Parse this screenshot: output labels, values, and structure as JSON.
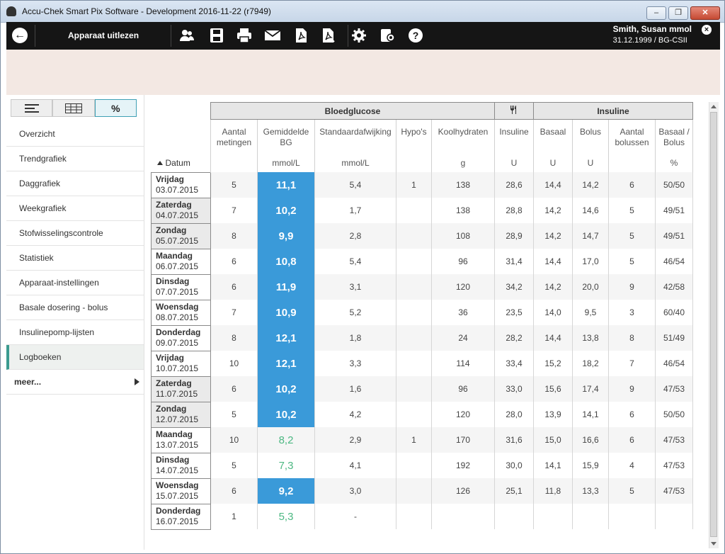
{
  "window": {
    "title": "Accu-Chek Smart Pix Software - Development 2016-11-22 (r7949)",
    "minimize": "–",
    "restore": "❐",
    "close": "✕"
  },
  "toolbar": {
    "back_icon": "arrow-left-icon",
    "title": "Apparaat uitlezen",
    "icons": [
      "users-icon",
      "save-icon",
      "print-icon",
      "mail-icon",
      "pdf-icon",
      "pdf-export-icon",
      "settings-icon",
      "device-settings-icon",
      "help-icon"
    ],
    "user_name": "Smith, Susan mmol",
    "user_dob": "31.12.1999 / BG-CSII",
    "close_icon": "close-icon"
  },
  "left": {
    "view_toggle": {
      "list": "list-view-icon",
      "table": "table-view-icon",
      "percent_label": "%"
    },
    "nav": [
      {
        "label": "Overzicht"
      },
      {
        "label": "Trendgrafiek"
      },
      {
        "label": "Daggrafiek"
      },
      {
        "label": "Weekgrafiek"
      },
      {
        "label": "Stofwisselingscontrole"
      },
      {
        "label": "Statistiek"
      },
      {
        "label": "Apparaat-instellingen"
      },
      {
        "label": "Basale dosering - bolus"
      },
      {
        "label": "Insulinepomp-lijsten"
      },
      {
        "label": "Logboeken",
        "active": true
      },
      {
        "label": "meer..."
      }
    ]
  },
  "table": {
    "group_headers": {
      "bg": "Bloedglucose",
      "food_icon": "cutlery-icon",
      "insulin": "Insuline"
    },
    "columns": {
      "datum": "Datum",
      "aantal": "Aantal metingen",
      "gem_bg": "Gemiddelde BG",
      "gem_bg_unit": "mmol/L",
      "sd": "Standaardafwijking",
      "sd_unit": "mmol/L",
      "hypos": "Hypo's",
      "kh": "Koolhydraten",
      "kh_unit": "g",
      "ins": "Insuline",
      "ins_unit": "U",
      "bas": "Basaal",
      "bas_unit": "U",
      "bol": "Bolus",
      "bol_unit": "U",
      "aant_bol": "Aantal bolussen",
      "bas_bol": "Basaal / Bolus",
      "bas_bol_unit": "%"
    },
    "rows": [
      {
        "day": "Vrijdag",
        "date": "03.07.2015",
        "n": "5",
        "bg": "11,1",
        "bg_high": true,
        "sd": "5,4",
        "hypo": "1",
        "kh": "138",
        "ins": "28,6",
        "bas": "14,4",
        "bol": "14,2",
        "nb": "6",
        "bb": "50/50",
        "weekend": false
      },
      {
        "day": "Zaterdag",
        "date": "04.07.2015",
        "n": "7",
        "bg": "10,2",
        "bg_high": true,
        "sd": "1,7",
        "hypo": "",
        "kh": "138",
        "ins": "28,8",
        "bas": "14,2",
        "bol": "14,6",
        "nb": "5",
        "bb": "49/51",
        "weekend": true
      },
      {
        "day": "Zondag",
        "date": "05.07.2015",
        "n": "8",
        "bg": "9,9",
        "bg_high": true,
        "sd": "2,8",
        "hypo": "",
        "kh": "108",
        "ins": "28,9",
        "bas": "14,2",
        "bol": "14,7",
        "nb": "5",
        "bb": "49/51",
        "weekend": true
      },
      {
        "day": "Maandag",
        "date": "06.07.2015",
        "n": "6",
        "bg": "10,8",
        "bg_high": true,
        "sd": "5,4",
        "hypo": "",
        "kh": "96",
        "ins": "31,4",
        "bas": "14,4",
        "bol": "17,0",
        "nb": "5",
        "bb": "46/54",
        "weekend": false
      },
      {
        "day": "Dinsdag",
        "date": "07.07.2015",
        "n": "6",
        "bg": "11,9",
        "bg_high": true,
        "sd": "3,1",
        "hypo": "",
        "kh": "120",
        "ins": "34,2",
        "bas": "14,2",
        "bol": "20,0",
        "nb": "9",
        "bb": "42/58",
        "weekend": false
      },
      {
        "day": "Woensdag",
        "date": "08.07.2015",
        "n": "7",
        "bg": "10,9",
        "bg_high": true,
        "sd": "5,2",
        "hypo": "",
        "kh": "36",
        "ins": "23,5",
        "bas": "14,0",
        "bol": "9,5",
        "nb": "3",
        "bb": "60/40",
        "weekend": false
      },
      {
        "day": "Donderdag",
        "date": "09.07.2015",
        "n": "8",
        "bg": "12,1",
        "bg_high": true,
        "sd": "1,8",
        "hypo": "",
        "kh": "24",
        "ins": "28,2",
        "bas": "14,4",
        "bol": "13,8",
        "nb": "8",
        "bb": "51/49",
        "weekend": false
      },
      {
        "day": "Vrijdag",
        "date": "10.07.2015",
        "n": "10",
        "bg": "12,1",
        "bg_high": true,
        "sd": "3,3",
        "hypo": "",
        "kh": "114",
        "ins": "33,4",
        "bas": "15,2",
        "bol": "18,2",
        "nb": "7",
        "bb": "46/54",
        "weekend": false
      },
      {
        "day": "Zaterdag",
        "date": "11.07.2015",
        "n": "6",
        "bg": "10,2",
        "bg_high": true,
        "sd": "1,6",
        "hypo": "",
        "kh": "96",
        "ins": "33,0",
        "bas": "15,6",
        "bol": "17,4",
        "nb": "9",
        "bb": "47/53",
        "weekend": true
      },
      {
        "day": "Zondag",
        "date": "12.07.2015",
        "n": "5",
        "bg": "10,2",
        "bg_high": true,
        "sd": "4,2",
        "hypo": "",
        "kh": "120",
        "ins": "28,0",
        "bas": "13,9",
        "bol": "14,1",
        "nb": "6",
        "bb": "50/50",
        "weekend": true
      },
      {
        "day": "Maandag",
        "date": "13.07.2015",
        "n": "10",
        "bg": "8,2",
        "bg_high": false,
        "sd": "2,9",
        "hypo": "1",
        "kh": "170",
        "ins": "31,6",
        "bas": "15,0",
        "bol": "16,6",
        "nb": "6",
        "bb": "47/53",
        "weekend": false
      },
      {
        "day": "Dinsdag",
        "date": "14.07.2015",
        "n": "5",
        "bg": "7,3",
        "bg_high": false,
        "sd": "4,1",
        "hypo": "",
        "kh": "192",
        "ins": "30,0",
        "bas": "14,1",
        "bol": "15,9",
        "nb": "4",
        "bb": "47/53",
        "weekend": false
      },
      {
        "day": "Woensdag",
        "date": "15.07.2015",
        "n": "6",
        "bg": "9,2",
        "bg_high": true,
        "sd": "3,0",
        "hypo": "",
        "kh": "126",
        "ins": "25,1",
        "bas": "11,8",
        "bol": "13,3",
        "nb": "5",
        "bb": "47/53",
        "weekend": false
      },
      {
        "day": "Donderdag",
        "date": "16.07.2015",
        "n": "1",
        "bg": "5,3",
        "bg_high": false,
        "sd": "-",
        "hypo": "",
        "kh": "",
        "ins": "",
        "bas": "",
        "bol": "",
        "nb": "",
        "bb": "",
        "weekend": false
      }
    ]
  },
  "colors": {
    "bg_high": "#3a9ad9",
    "bg_normal": "#4db883",
    "active_nav": "#3b9b8f"
  }
}
